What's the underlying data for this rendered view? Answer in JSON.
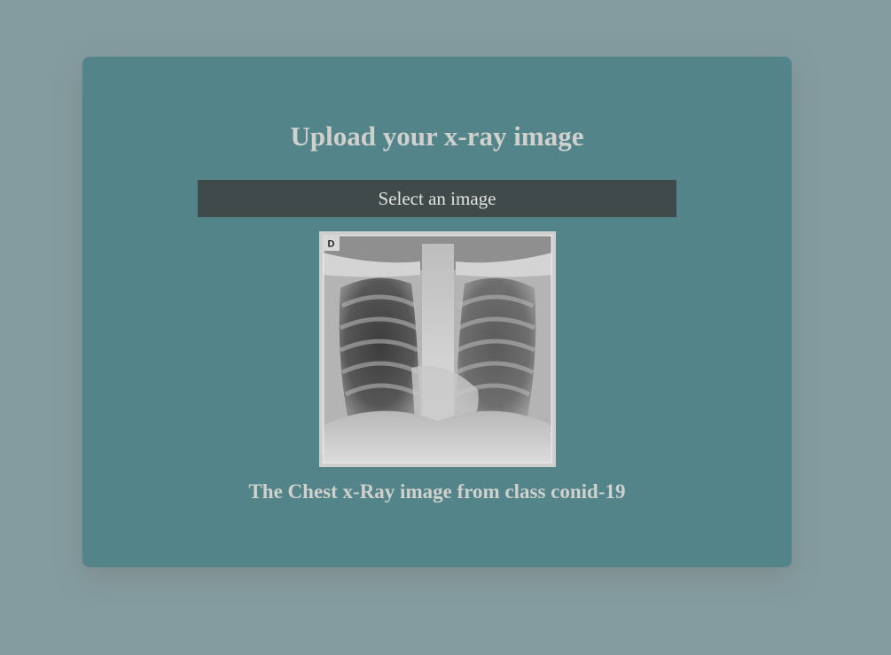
{
  "upload": {
    "title": "Upload your x-ray image",
    "select_label": "Select an image",
    "image_marker": "D",
    "caption": "The Chest x-Ray image from class conid-19"
  },
  "icons": {
    "preview": "chest-xray-image"
  },
  "colors": {
    "page_background": "#849ca0",
    "card_background": "#52848a",
    "button_background": "#414a4a",
    "text": "#d0d0cc"
  }
}
